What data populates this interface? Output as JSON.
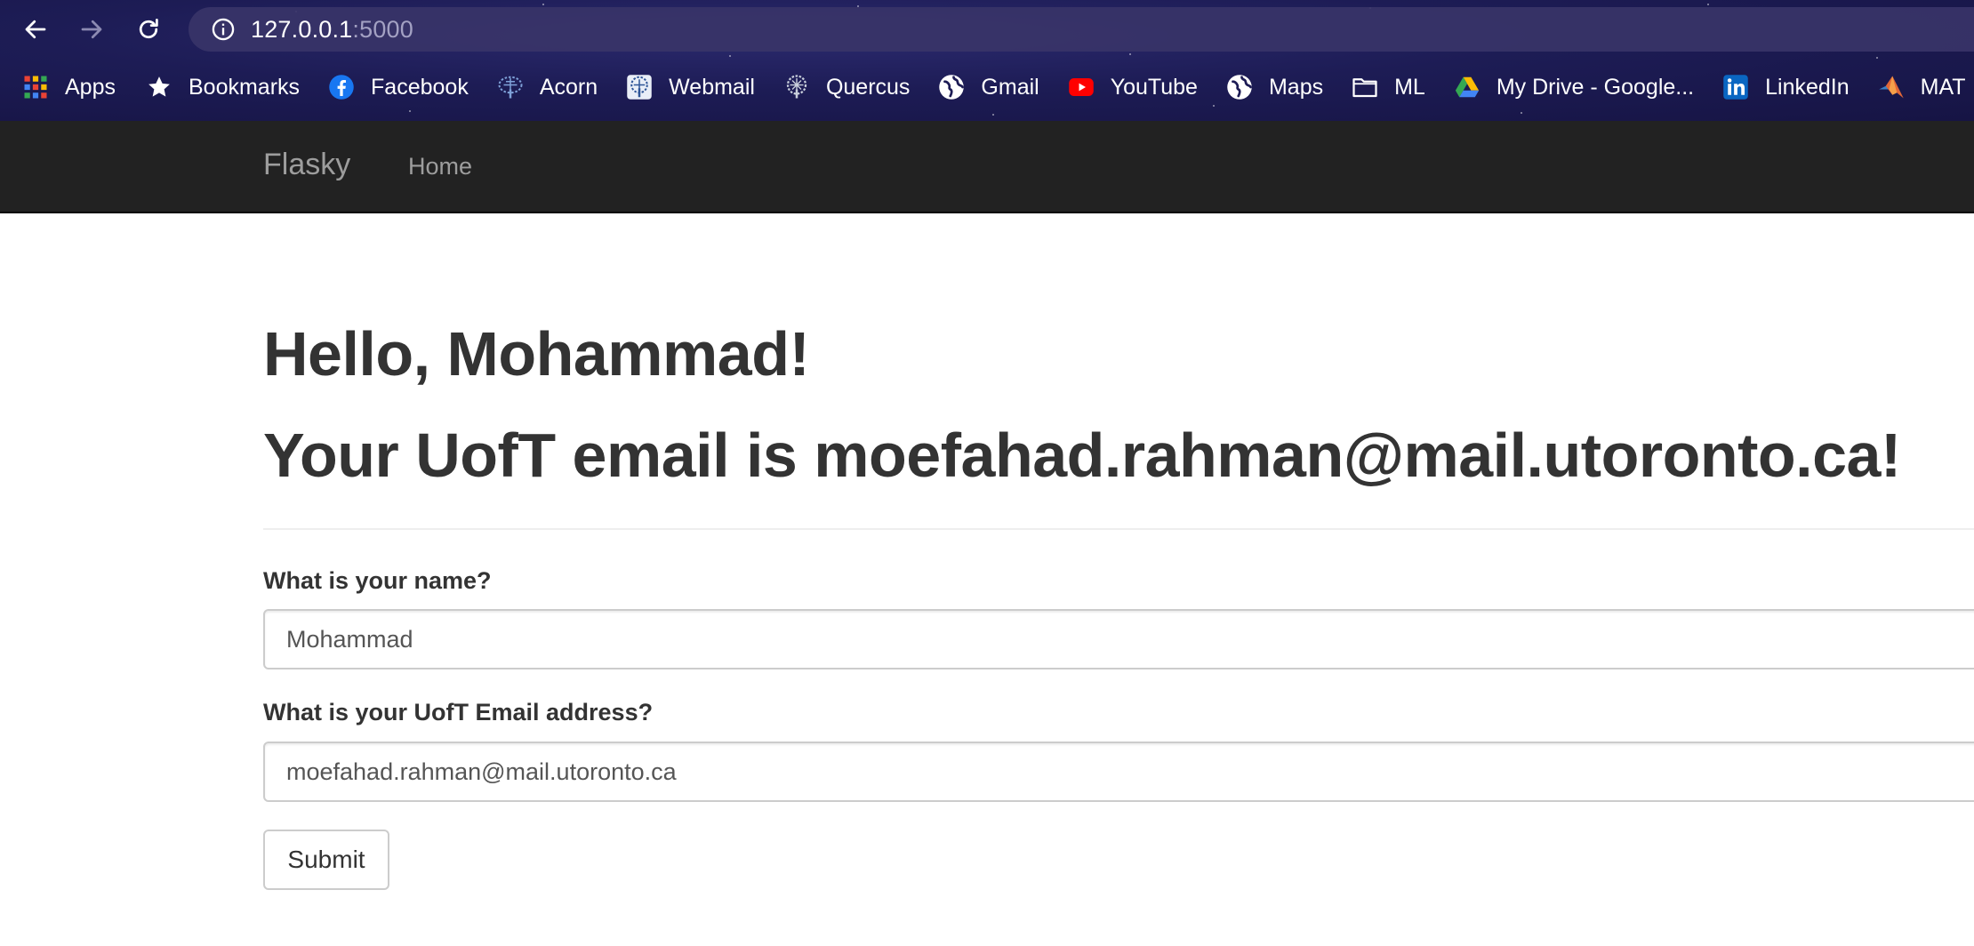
{
  "browser": {
    "url_host": "127.0.0.1",
    "url_port": ":5000",
    "bookmarks": [
      {
        "label": "Apps",
        "icon": "apps-grid-icon"
      },
      {
        "label": "Bookmarks",
        "icon": "star-icon"
      },
      {
        "label": "Facebook",
        "icon": "facebook-icon"
      },
      {
        "label": "Acorn",
        "icon": "acorn-tree-icon"
      },
      {
        "label": "Webmail",
        "icon": "webmail-tree-icon"
      },
      {
        "label": "Quercus",
        "icon": "quercus-tree-icon"
      },
      {
        "label": "Gmail",
        "icon": "globe-icon"
      },
      {
        "label": "YouTube",
        "icon": "youtube-icon"
      },
      {
        "label": "Maps",
        "icon": "globe-icon"
      },
      {
        "label": "ML",
        "icon": "folder-icon"
      },
      {
        "label": "My Drive - Google...",
        "icon": "google-drive-icon"
      },
      {
        "label": "LinkedIn",
        "icon": "linkedin-icon"
      },
      {
        "label": "MAT",
        "icon": "matlab-icon"
      }
    ]
  },
  "navbar": {
    "brand": "Flasky",
    "home": "Home"
  },
  "main": {
    "greeting": "Hello, Mohammad!",
    "email_line": "Your UofT email is moefahad.rahman@mail.utoronto.ca!",
    "name_label": "What is your name?",
    "name_value": "Mohammad",
    "email_label": "What is your UofT Email address?",
    "email_value": "moefahad.rahman@mail.utoronto.ca",
    "submit_label": "Submit"
  }
}
